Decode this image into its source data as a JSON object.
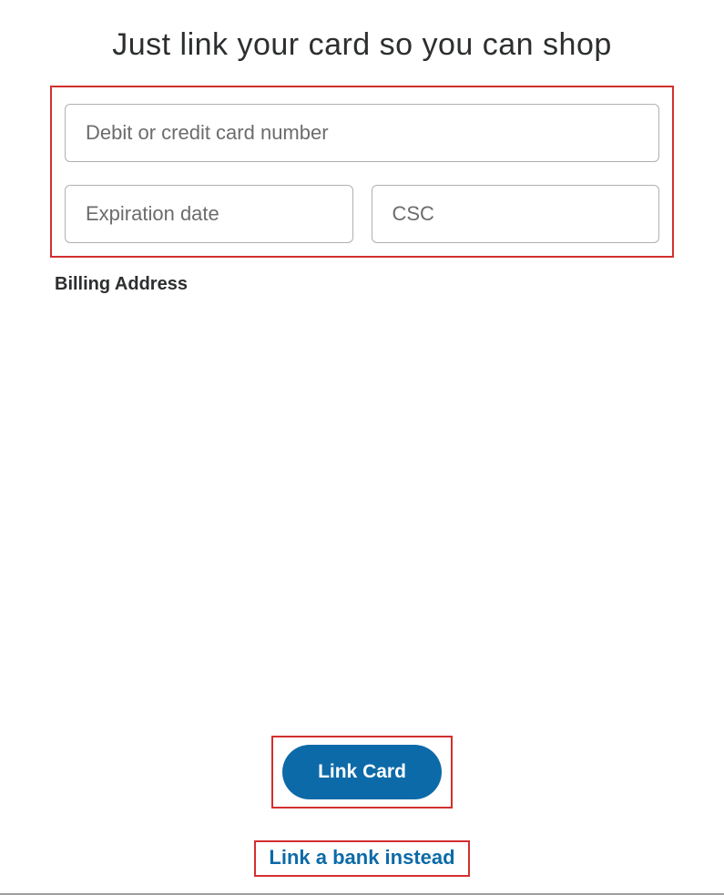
{
  "title": "Just link your card so you can shop",
  "fields": {
    "card_number": {
      "placeholder": "Debit or credit card number",
      "value": ""
    },
    "expiration": {
      "placeholder": "Expiration date",
      "value": ""
    },
    "csc": {
      "placeholder": "CSC",
      "value": ""
    }
  },
  "billing_label": "Billing Address",
  "actions": {
    "link_card_label": "Link Card",
    "link_bank_label": "Link a bank instead"
  },
  "colors": {
    "highlight": "#d32f2f",
    "primary": "#0d6aa8"
  }
}
